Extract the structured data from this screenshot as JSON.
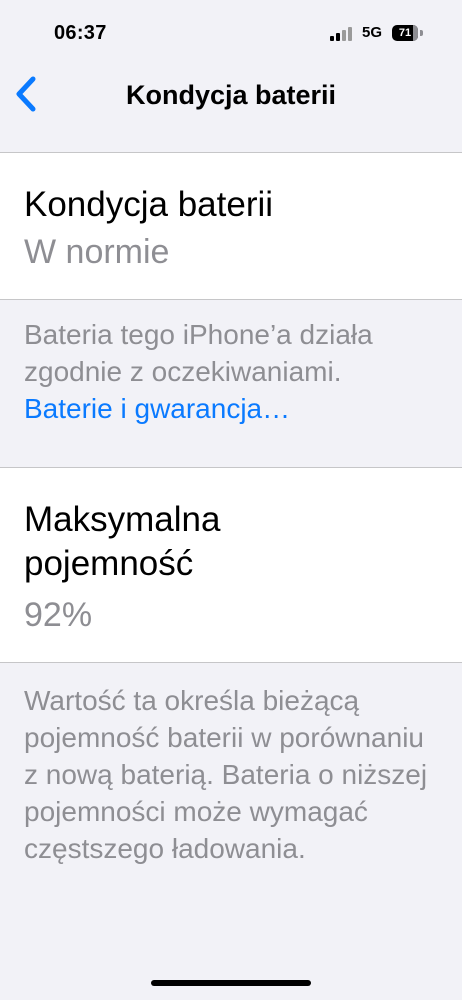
{
  "status": {
    "time": "06:37",
    "network": "5G",
    "battery_level": "71"
  },
  "nav": {
    "title": "Kondycja baterii"
  },
  "battery_health": {
    "title": "Kondycja baterii",
    "value": "W normie",
    "description": "Bateria tego iPhone’a działa zgodnie z oczekiwaniami.",
    "link": "Baterie i gwarancja…"
  },
  "max_capacity": {
    "title": "Maksymalna pojemność",
    "value": "92%",
    "description": "Wartość ta określa bieżącą pojemność baterii w porównaniu z nową baterią. Bateria o niższej pojemności może wymagać częstszego ładowania."
  },
  "colors": {
    "accent": "#0a7aff",
    "secondary_text": "#8e8e93",
    "background": "#f2f2f7"
  }
}
